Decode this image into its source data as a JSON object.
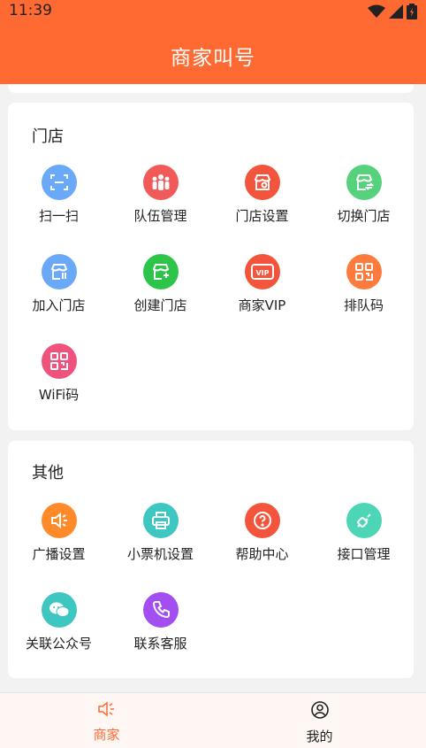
{
  "status": {
    "time": "11:39"
  },
  "header": {
    "title": "商家叫号"
  },
  "colors": {
    "brand": "#ff6a33",
    "active_tab": "#ff6a33"
  },
  "store_section": {
    "title": "门店",
    "items": [
      {
        "label": "扫一扫",
        "icon": "scan-icon",
        "color": "#6aa9f7"
      },
      {
        "label": "队伍管理",
        "icon": "team-icon",
        "color": "#f25a5a"
      },
      {
        "label": "门店设置",
        "icon": "store-settings-icon",
        "color": "#f2553c"
      },
      {
        "label": "切换门店",
        "icon": "switch-store-icon",
        "color": "#56d27c"
      },
      {
        "label": "加入门店",
        "icon": "join-store-icon",
        "color": "#6aa9f7"
      },
      {
        "label": "创建门店",
        "icon": "create-store-icon",
        "color": "#2cc54a"
      },
      {
        "label": "商家VIP",
        "icon": "vip-icon",
        "color": "#f2553c"
      },
      {
        "label": "排队码",
        "icon": "queue-code-icon",
        "color": "#ff7a3d"
      },
      {
        "label": "WiFi码",
        "icon": "wifi-code-icon",
        "color": "#f0527e"
      }
    ]
  },
  "other_section": {
    "title": "其他",
    "items": [
      {
        "label": "广播设置",
        "icon": "broadcast-icon",
        "color": "#ff8a2a"
      },
      {
        "label": "小票机设置",
        "icon": "printer-icon",
        "color": "#3ec7c0"
      },
      {
        "label": "帮助中心",
        "icon": "help-icon",
        "color": "#f2553c"
      },
      {
        "label": "接口管理",
        "icon": "api-icon",
        "color": "#4dd6b6"
      },
      {
        "label": "关联公众号",
        "icon": "wechat-icon",
        "color": "#3ec7c0"
      },
      {
        "label": "联系客服",
        "icon": "phone-icon",
        "color": "#a24ef0"
      }
    ]
  },
  "tabbar": {
    "tabs": [
      {
        "label": "商家",
        "icon": "speaker-icon",
        "active": true
      },
      {
        "label": "我的",
        "icon": "user-icon",
        "active": false
      }
    ]
  }
}
